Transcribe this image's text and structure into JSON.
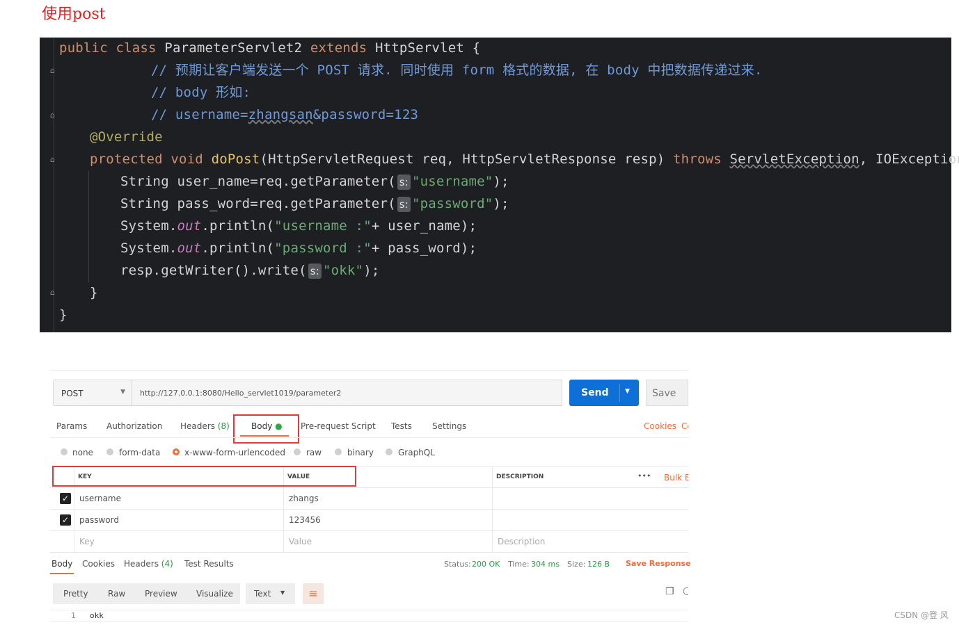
{
  "heading": "使用post",
  "code": {
    "l1": [
      "public class ",
      "ParameterServlet2 ",
      "extends ",
      "HttpServlet {"
    ],
    "l2": "// 预期让客户端发送一个 POST 请求. 同时使用 form 格式的数据, 在 body 中把数据传递过来.",
    "l3": "// body 形如:",
    "l4a": "// username=",
    "l4b": "zhangsan",
    "l4c": "&password=123",
    "l5": "@Override",
    "l6": [
      "protected void ",
      "doPost",
      "(HttpServletRequest req, HttpServletResponse resp) ",
      "throws ",
      "ServletException",
      ", IOException {"
    ],
    "l7a": "String user_name=req.getParameter(",
    "l7hint": "s:",
    "l7str": "\"username\"",
    "l7end": ");",
    "l8a": "String pass_word=req.getParameter(",
    "l8hint": "s:",
    "l8str": "\"password\"",
    "l8end": ");",
    "l9a": "System.",
    "l9out": "out",
    "l9b": ".println(",
    "l9str": "\"username :\"",
    "l9c": "+ user_name);",
    "l10a": "System.",
    "l10out": "out",
    "l10b": ".println(",
    "l10str": "\"password :\"",
    "l10c": "+ pass_word);",
    "l11a": "resp.getWriter().write(",
    "l11hint": "s:",
    "l11str": "\"okk\"",
    "l11end": ");",
    "l12": "}",
    "l13": "}"
  },
  "postman": {
    "method": "POST",
    "url": "http://127.0.0.1:8080/Hello_servlet1019/parameter2",
    "send": "Send",
    "save": "Save",
    "tabs": [
      "Params",
      "Authorization",
      "Headers",
      "Body",
      "Pre-request Script",
      "Tests",
      "Settings"
    ],
    "headers_count": "(8)",
    "cookies": "Cookies",
    "code_link": "Co",
    "body_types": [
      "none",
      "form-data",
      "x-www-form-urlencoded",
      "raw",
      "binary",
      "GraphQL"
    ],
    "table_headers": [
      "KEY",
      "VALUE",
      "DESCRIPTION"
    ],
    "more": "•••",
    "bulk_edit": "Bulk E",
    "rows": [
      {
        "key": "username",
        "value": "zhangs"
      },
      {
        "key": "password",
        "value": "123456"
      }
    ],
    "placeholders": {
      "key": "Key",
      "value": "Value",
      "description": "Description"
    },
    "resp_tabs": [
      "Body",
      "Cookies",
      "Headers",
      "Test Results"
    ],
    "resp_headers_count": "(4)",
    "status_label": "Status:",
    "status_value": "200 OK",
    "time_label": "Time:",
    "time_value": "304 ms",
    "size_label": "Size:",
    "size_value": "126 B",
    "save_response": "Save Response",
    "view_modes": [
      "Pretty",
      "Raw",
      "Preview",
      "Visualize"
    ],
    "format": "Text",
    "line_no": "1",
    "response_text": "okk"
  },
  "watermark": "CSDN @登 风"
}
